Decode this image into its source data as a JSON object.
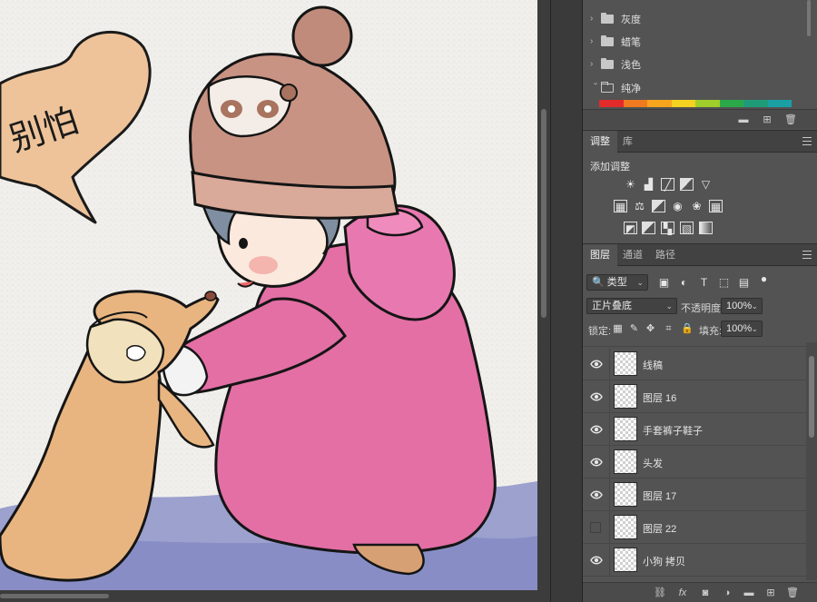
{
  "canvas": {
    "speech_text": "别怕"
  },
  "swatches": {
    "folders": [
      {
        "name": "灰度",
        "open": false
      },
      {
        "name": "蜡笔",
        "open": false
      },
      {
        "name": "浅色",
        "open": false
      },
      {
        "name": "纯净",
        "open": true
      }
    ],
    "strip_colors": [
      "#e42b2b",
      "#f07a1f",
      "#f6a51c",
      "#f5d21f",
      "#9fce2b",
      "#2aa84a",
      "#1f9b7a",
      "#1a9fa3"
    ],
    "footer_icons": [
      "new-group-icon",
      "new-swatch-icon",
      "delete-icon"
    ]
  },
  "adjustments": {
    "tabs": [
      "调整",
      "库"
    ],
    "active_tab": "调整",
    "title": "添加调整",
    "icons_row1": [
      "brightness-icon",
      "levels-icon",
      "curves-icon",
      "exposure-icon",
      "vibrance-icon"
    ],
    "icons_row2": [
      "hue-saturation-icon",
      "color-balance-icon",
      "black-white-icon",
      "photo-filter-icon",
      "channel-mixer-icon",
      "color-lookup-icon"
    ],
    "icons_row3": [
      "invert-icon",
      "posterize-icon",
      "threshold-icon",
      "selective-color-icon",
      "gradient-map-icon"
    ]
  },
  "layers": {
    "tabs": [
      "图层",
      "通道",
      "路径"
    ],
    "active_tab": "图层",
    "filter": {
      "label": "类型"
    },
    "blend_mode": "正片叠底",
    "opacity_label": "不透明度:",
    "opacity_value": "100%",
    "lock_label": "锁定:",
    "fill_label": "填充:",
    "fill_value": "100%",
    "items": [
      {
        "name": "线稿",
        "visible": true
      },
      {
        "name": "图层 16",
        "visible": true
      },
      {
        "name": "手套裤子鞋子",
        "visible": true
      },
      {
        "name": "头发",
        "visible": true
      },
      {
        "name": "图层 17",
        "visible": true
      },
      {
        "name": "图层 22",
        "visible": false
      },
      {
        "name": "小狗 拷贝",
        "visible": true
      }
    ],
    "footer_icons": [
      "link-icon",
      "fx-icon",
      "mask-icon",
      "adjustment-icon",
      "group-icon",
      "new-layer-icon",
      "delete-icon"
    ],
    "footer_fx_label": "fx"
  }
}
